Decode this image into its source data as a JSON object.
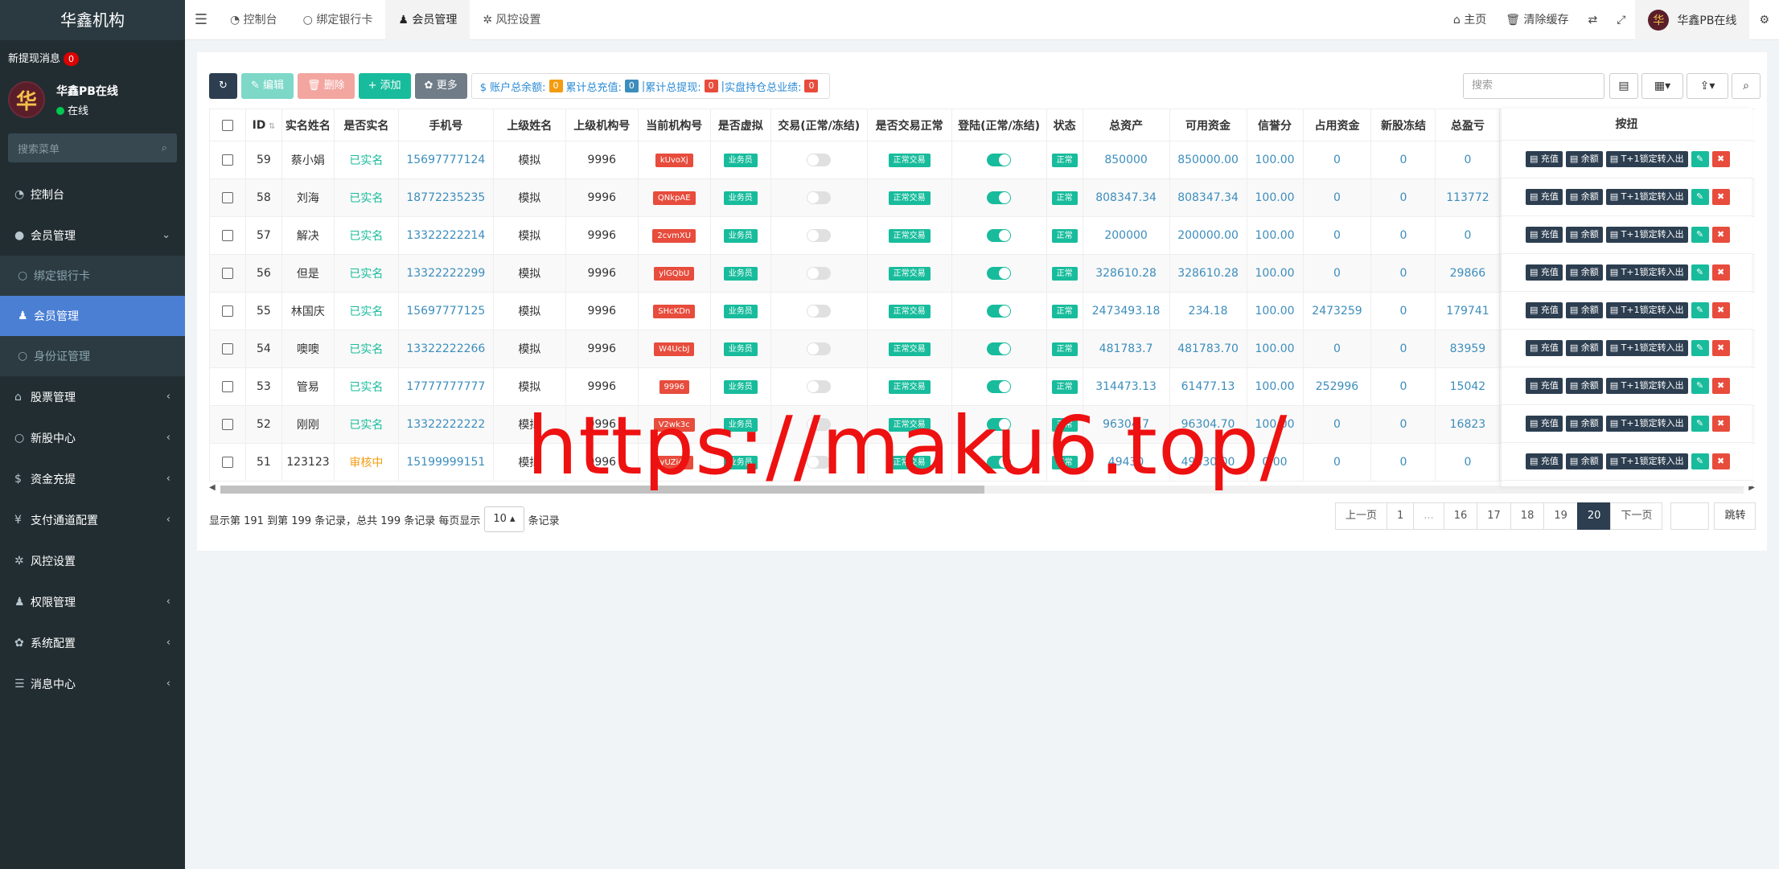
{
  "sidebar": {
    "brand": "华鑫机构",
    "notice_label": "新提现消息",
    "notice_count": "0",
    "avatar_char": "华",
    "user_name": "华鑫PB在线",
    "user_status": "在线",
    "search_placeholder": "搜索菜单",
    "menu": {
      "dashboard": "控制台",
      "member_mgmt": "会员管理",
      "bind_card": "绑定银行卡",
      "member_mgmt_sub": "会员管理",
      "id_mgmt": "身份证管理",
      "stock_mgmt": "股票管理",
      "ipo_center": "新股中心",
      "funds": "资金充提",
      "payment": "支付通道配置",
      "risk": "风控设置",
      "perm": "权限管理",
      "system": "系统配置",
      "messages": "消息中心"
    }
  },
  "topbar": {
    "tabs": [
      "控制台",
      "绑定银行卡",
      "会员管理",
      "风控设置"
    ],
    "home": "主页",
    "clear_cache": "清除缓存",
    "user": "华鑫PB在线"
  },
  "toolbar": {
    "edit": "编辑",
    "delete": "删除",
    "add": "添加",
    "more": "更多",
    "stat1_label": "$ 账户总余额:",
    "stat1_val": "0",
    "stat2_label": "累计总充值:",
    "stat2_val": "0",
    "stat3_label": "累计总提现:",
    "stat3_val": "0",
    "stat4_label": "实盘持仓总业绩:",
    "stat4_val": "0",
    "search_placeholder": "搜索"
  },
  "table": {
    "headers": [
      "ID",
      "实名姓名",
      "是否实名",
      "手机号",
      "上级姓名",
      "上级机构号",
      "当前机构号",
      "是否虚拟",
      "交易(正常/冻结)",
      "是否交易正常",
      "登陆(正常/冻结)",
      "状态",
      "总资产",
      "可用资金",
      "信誉分",
      "占用资金",
      "新股冻结",
      "总盈亏"
    ],
    "ops_header": "按扭",
    "rows": [
      {
        "id": "59",
        "name": "蔡小娟",
        "verified": "已实名",
        "phone": "15697777124",
        "parent": "模拟",
        "parent_org": "9996",
        "org": "kUvoXj",
        "virtual": "业务员",
        "trade_on": false,
        "trade_ok": "正常交易",
        "login_on": true,
        "status": "正常",
        "total": "850000",
        "avail": "850000.00",
        "credit": "100.00",
        "occupied": "0",
        "ipo": "0",
        "pnl": "0"
      },
      {
        "id": "58",
        "name": "刘海",
        "verified": "已实名",
        "phone": "18772235235",
        "parent": "模拟",
        "parent_org": "9996",
        "org": "QNkpAE",
        "virtual": "业务员",
        "trade_on": false,
        "trade_ok": "正常交易",
        "login_on": true,
        "status": "正常",
        "total": "808347.34",
        "avail": "808347.34",
        "credit": "100.00",
        "occupied": "0",
        "ipo": "0",
        "pnl": "113772"
      },
      {
        "id": "57",
        "name": "解决",
        "verified": "已实名",
        "phone": "13322222214",
        "parent": "模拟",
        "parent_org": "9996",
        "org": "2cvmXU",
        "virtual": "业务员",
        "trade_on": false,
        "trade_ok": "正常交易",
        "login_on": true,
        "status": "正常",
        "total": "200000",
        "avail": "200000.00",
        "credit": "100.00",
        "occupied": "0",
        "ipo": "0",
        "pnl": "0"
      },
      {
        "id": "56",
        "name": "但是",
        "verified": "已实名",
        "phone": "13322222299",
        "parent": "模拟",
        "parent_org": "9996",
        "org": "ylGQbU",
        "virtual": "业务员",
        "trade_on": false,
        "trade_ok": "正常交易",
        "login_on": true,
        "status": "正常",
        "total": "328610.28",
        "avail": "328610.28",
        "credit": "100.00",
        "occupied": "0",
        "ipo": "0",
        "pnl": "29866"
      },
      {
        "id": "55",
        "name": "林国庆",
        "verified": "已实名",
        "phone": "15697777125",
        "parent": "模拟",
        "parent_org": "9996",
        "org": "SHcKDn",
        "virtual": "业务员",
        "trade_on": false,
        "trade_ok": "正常交易",
        "login_on": true,
        "status": "正常",
        "total": "2473493.18",
        "avail": "234.18",
        "credit": "100.00",
        "occupied": "2473259",
        "ipo": "0",
        "pnl": "179741"
      },
      {
        "id": "54",
        "name": "噢噢",
        "verified": "已实名",
        "phone": "13322222266",
        "parent": "模拟",
        "parent_org": "9996",
        "org": "W4UcbJ",
        "virtual": "业务员",
        "trade_on": false,
        "trade_ok": "正常交易",
        "login_on": true,
        "status": "正常",
        "total": "481783.7",
        "avail": "481783.70",
        "credit": "100.00",
        "occupied": "0",
        "ipo": "0",
        "pnl": "83959"
      },
      {
        "id": "53",
        "name": "管易",
        "verified": "已实名",
        "phone": "17777777777",
        "parent": "模拟",
        "parent_org": "9996",
        "org": "9996",
        "virtual": "业务员",
        "trade_on": false,
        "trade_ok": "正常交易",
        "login_on": true,
        "status": "正常",
        "total": "314473.13",
        "avail": "61477.13",
        "credit": "100.00",
        "occupied": "252996",
        "ipo": "0",
        "pnl": "15042"
      },
      {
        "id": "52",
        "name": "刚刚",
        "verified": "已实名",
        "phone": "13322222222",
        "parent": "模拟",
        "parent_org": "9996",
        "org": "V2wk3c",
        "virtual": "业务员",
        "trade_on": false,
        "trade_ok": "正常交易",
        "login_on": true,
        "status": "正常",
        "total": "96304.7",
        "avail": "96304.70",
        "credit": "100.00",
        "occupied": "0",
        "ipo": "0",
        "pnl": "16823"
      },
      {
        "id": "51",
        "name": "123123",
        "verified": "审核中",
        "phone": "15199999151",
        "parent": "模拟",
        "parent_org": "9996",
        "org": "yUZi47",
        "virtual": "业务员",
        "trade_on": false,
        "trade_ok": "正常交易",
        "login_on": true,
        "status": "正常",
        "total": "49430",
        "avail": "49430.00",
        "credit": "0.00",
        "occupied": "0",
        "ipo": "0",
        "pnl": "0"
      }
    ],
    "ops": {
      "recharge": "充值",
      "balance": "余额",
      "t1": "T+1锁定转入出"
    }
  },
  "footer": {
    "info_prefix": "显示第 191 到第 199 条记录，总共 199 条记录 每页显示",
    "page_size": "10",
    "info_suffix": "条记录",
    "prev": "上一页",
    "pages": [
      "1",
      "...",
      "16",
      "17",
      "18",
      "19",
      "20"
    ],
    "next": "下一页",
    "jump": "跳转"
  },
  "watermark": "https://maku6.top/",
  "colors": {
    "sidebar_bg": "#222d32",
    "accent": "#4a7fd4",
    "green": "#18bc9c",
    "red": "#e74c3c",
    "dark": "#2c3e50"
  }
}
